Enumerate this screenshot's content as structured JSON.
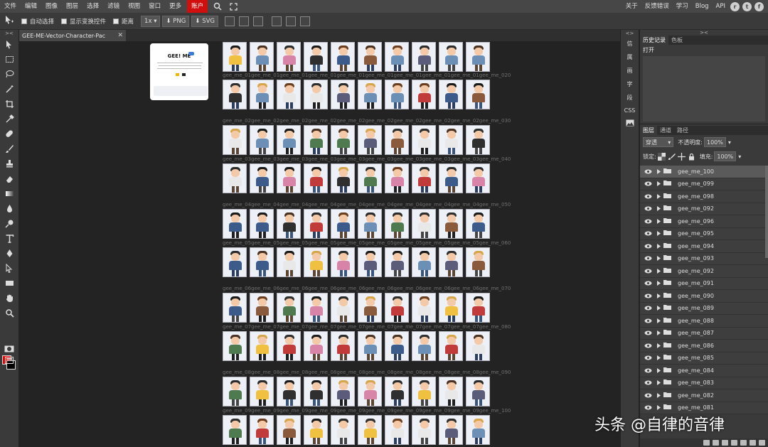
{
  "menu": {
    "items": [
      "文件",
      "编辑",
      "图像",
      "图层",
      "选择",
      "滤镜",
      "视图",
      "窗口",
      "更多"
    ],
    "account": "账户",
    "right_items": [
      "关于",
      "反馈错误",
      "学习",
      "Blog",
      "API"
    ]
  },
  "options": {
    "auto_select": "自动选择",
    "show_transform": "显示变换控件",
    "distance": "距离",
    "zoom": "1x",
    "png": "PNG",
    "svg": "SVG"
  },
  "document": {
    "tab_title": "GEE-ME-Vector-Character-Pac",
    "cover_brand": "GEE! ME"
  },
  "grid": {
    "row_labels": [
      "gee_me_01gee_me_01gee_me_01gee_me_01gee_me_01gee_me_01gee_me_01gee_me_01gee_me_01gee_me_020",
      "gee_me_02gee_me_02gee_me_02gee_me_02gee_me_02gee_me_02gee_me_02gee_me_02gee_me_02gee_me_030",
      "gee_me_03gee_me_03gee_me_03gee_me_03gee_me_03gee_me_03gee_me_03gee_me_03gee_me_03gee_me_040",
      "gee_me_04gee_me_04gee_me_04gee_me_04gee_me_04gee_me_04gee_me_04gee_me_04gee_me_04gee_me_050",
      "gee_me_05gee_me_05gee_me_05gee_me_05gee_me_05gee_me_05gee_me_05gee_me_05gee_me_05gee_me_060",
      "gee_me_06gee_me_06gee_me_06gee_me_06gee_me_06gee_me_06gee_me_06gee_me_06gee_me_06gee_me_070",
      "gee_me_07gee_me_07gee_me_07gee_me_07gee_me_07gee_me_07gee_me_07gee_me_07gee_me_07gee_me_080",
      "gee_me_08gee_me_08gee_me_08gee_me_08gee_me_08gee_me_08gee_me_08gee_me_08gee_me_08gee_me_090",
      "gee_me_09gee_me_09gee_me_09gee_me_09gee_me_09gee_me_09gee_me_09gee_me_09gee_me_09gee_me_100"
    ]
  },
  "mid_panel": [
    "信",
    "属",
    "画",
    "字",
    "段",
    "CSS"
  ],
  "history": {
    "tabs": [
      "历史记录",
      "色板"
    ],
    "entry": "打开"
  },
  "layers_panel": {
    "tabs": [
      "图层",
      "通道",
      "路径"
    ],
    "blend_mode": "穿透",
    "opacity_label": "不透明度:",
    "opacity_value": "100%",
    "lock_label": "锁定:",
    "fill_label": "填充:",
    "fill_value": "100%",
    "layers": [
      "gee_me_100",
      "gee_me_099",
      "gee_me_098",
      "gee_me_092",
      "gee_me_096",
      "gee_me_095",
      "gee_me_094",
      "gee_me_093",
      "gee_me_092",
      "gee_me_091",
      "gee_me_090",
      "gee_me_089",
      "gee_me_088",
      "gee_me_087",
      "gee_me_086",
      "gee_me_085",
      "gee_me_084",
      "gee_me_083",
      "gee_me_082",
      "gee_me_081"
    ]
  },
  "watermark": "头条 @自律的音律",
  "colors": {
    "foreground": "#e00000",
    "background": "#000000",
    "account_red": "#d10f0f"
  }
}
